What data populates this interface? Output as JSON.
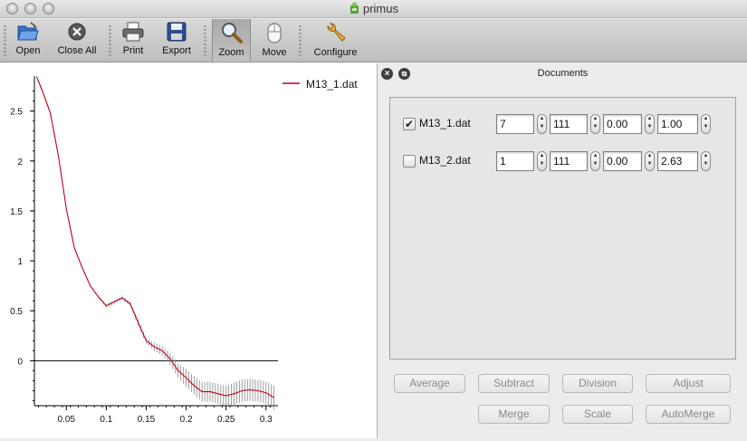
{
  "window": {
    "title": "primus"
  },
  "toolbar": {
    "open_label": "Open",
    "close_all_label": "Close All",
    "print_label": "Print",
    "export_label": "Export",
    "zoom_label": "Zoom",
    "move_label": "Move",
    "configure_label": "Configure",
    "active_tool": "Zoom"
  },
  "plot": {
    "legend": "M13_1.dat",
    "series_color": "#c0001a",
    "y_ticks": [
      "2.5",
      "2",
      "1.5",
      "1",
      "0.5",
      "0"
    ],
    "x_ticks": [
      "0.05",
      "0.1",
      "0.15",
      "0.2",
      "0.25",
      "0.3"
    ]
  },
  "chart_data": {
    "type": "line",
    "title": "",
    "xlabel": "",
    "ylabel": "",
    "xlim": [
      0.01,
      0.315
    ],
    "ylim": [
      -0.45,
      2.85
    ],
    "grid": false,
    "legend_position": "top-right",
    "series": [
      {
        "name": "M13_1.dat",
        "color": "#c0001a",
        "x": [
          0.013,
          0.02,
          0.03,
          0.04,
          0.05,
          0.06,
          0.07,
          0.08,
          0.09,
          0.1,
          0.11,
          0.12,
          0.13,
          0.14,
          0.15,
          0.16,
          0.17,
          0.18,
          0.19,
          0.2,
          0.21,
          0.22,
          0.23,
          0.24,
          0.25,
          0.26,
          0.27,
          0.28,
          0.29,
          0.3,
          0.31
        ],
        "y": [
          2.84,
          2.7,
          2.48,
          2.05,
          1.52,
          1.13,
          0.93,
          0.75,
          0.64,
          0.55,
          0.59,
          0.63,
          0.57,
          0.38,
          0.2,
          0.14,
          0.1,
          0.02,
          -0.1,
          -0.17,
          -0.25,
          -0.31,
          -0.31,
          -0.33,
          -0.35,
          -0.33,
          -0.3,
          -0.29,
          -0.3,
          -0.32,
          -0.37
        ],
        "error": [
          0.01,
          0.01,
          0.01,
          0.01,
          0.01,
          0.01,
          0.01,
          0.01,
          0.01,
          0.02,
          0.02,
          0.02,
          0.02,
          0.03,
          0.03,
          0.04,
          0.05,
          0.06,
          0.07,
          0.09,
          0.09,
          0.1,
          0.1,
          0.1,
          0.1,
          0.11,
          0.11,
          0.11,
          0.11,
          0.11,
          0.12
        ]
      }
    ]
  },
  "documents": {
    "title": "Documents",
    "rows": [
      {
        "name": "M13_1.dat",
        "checked": true,
        "first": "7",
        "last": "111",
        "offset": "0.00",
        "scale": "1.00"
      },
      {
        "name": "M13_2.dat",
        "checked": false,
        "first": "1",
        "last": "111",
        "offset": "0.00",
        "scale": "2.63"
      }
    ],
    "buttons": {
      "average": "Average",
      "subtract": "Subtract",
      "division": "Division",
      "adjust": "Adjust",
      "merge": "Merge",
      "scale": "Scale",
      "automerge": "AutoMerge"
    }
  }
}
